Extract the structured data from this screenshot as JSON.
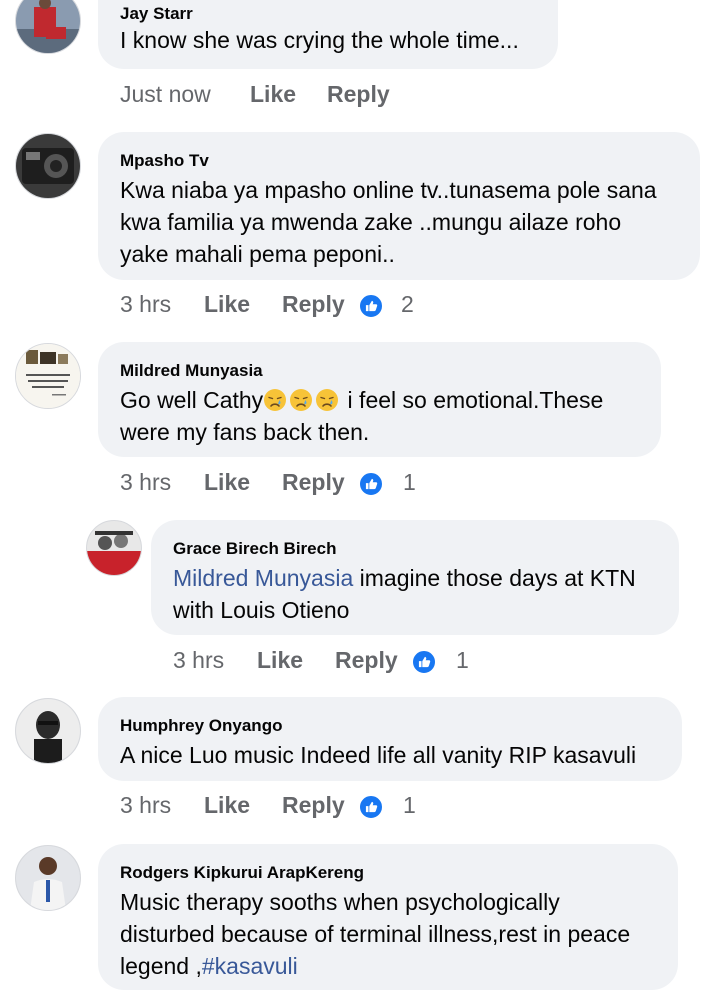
{
  "comments": [
    {
      "author": "Jay Starr",
      "text": "I know she was crying the whole time...",
      "time": "Just now",
      "like_label": "Like",
      "reply_label": "Reply",
      "reactions": ""
    },
    {
      "author": "Mpasho Tv",
      "text_lines": [
        "Kwa niaba ya mpasho online tv..tunasema pole sana",
        "kwa familia ya mwenda zake ..mungu ailaze roho",
        "yake mahali pema peponi.."
      ],
      "time": "3 hrs",
      "like_label": "Like",
      "reply_label": "Reply",
      "reactions": "2"
    },
    {
      "author": "Mildred Munyasia",
      "text_part1": "Go well Cathy",
      "text_part2": " i feel so emotional.These",
      "text_line2": "were my fans back then.",
      "emoji": "crying-face-emoji",
      "avatar_caption": "When the time is right I, the Lord, will make it happen.",
      "time": "3 hrs",
      "like_label": "Like",
      "reply_label": "Reply",
      "reactions": "1"
    },
    {
      "author": "Grace Birech Birech",
      "mention": "Mildred Munyasia",
      "text_after_mention": " imagine those days at KTN",
      "text_line2": "with Louis Otieno",
      "time": "3 hrs",
      "like_label": "Like",
      "reply_label": "Reply",
      "reactions": "1"
    },
    {
      "author": "Humphrey Onyango",
      "text": "A nice Luo music Indeed life all vanity RIP kasavuli",
      "time": "3 hrs",
      "like_label": "Like",
      "reply_label": "Reply",
      "reactions": "1"
    },
    {
      "author": "Rodgers Kipkurui ArapKereng",
      "text_lines": [
        "Music therapy sooths when psychologically",
        "disturbed because of terminal illness,rest in peace"
      ],
      "text_line3_prefix": "legend ,",
      "hashtag": "#kasavuli"
    }
  ],
  "colors": {
    "bubble": "#f0f2f5",
    "meta": "#65676b",
    "link": "#385898",
    "like_badge": "#1877f2"
  },
  "icons": {
    "reaction": "thumbs-up-icon"
  }
}
